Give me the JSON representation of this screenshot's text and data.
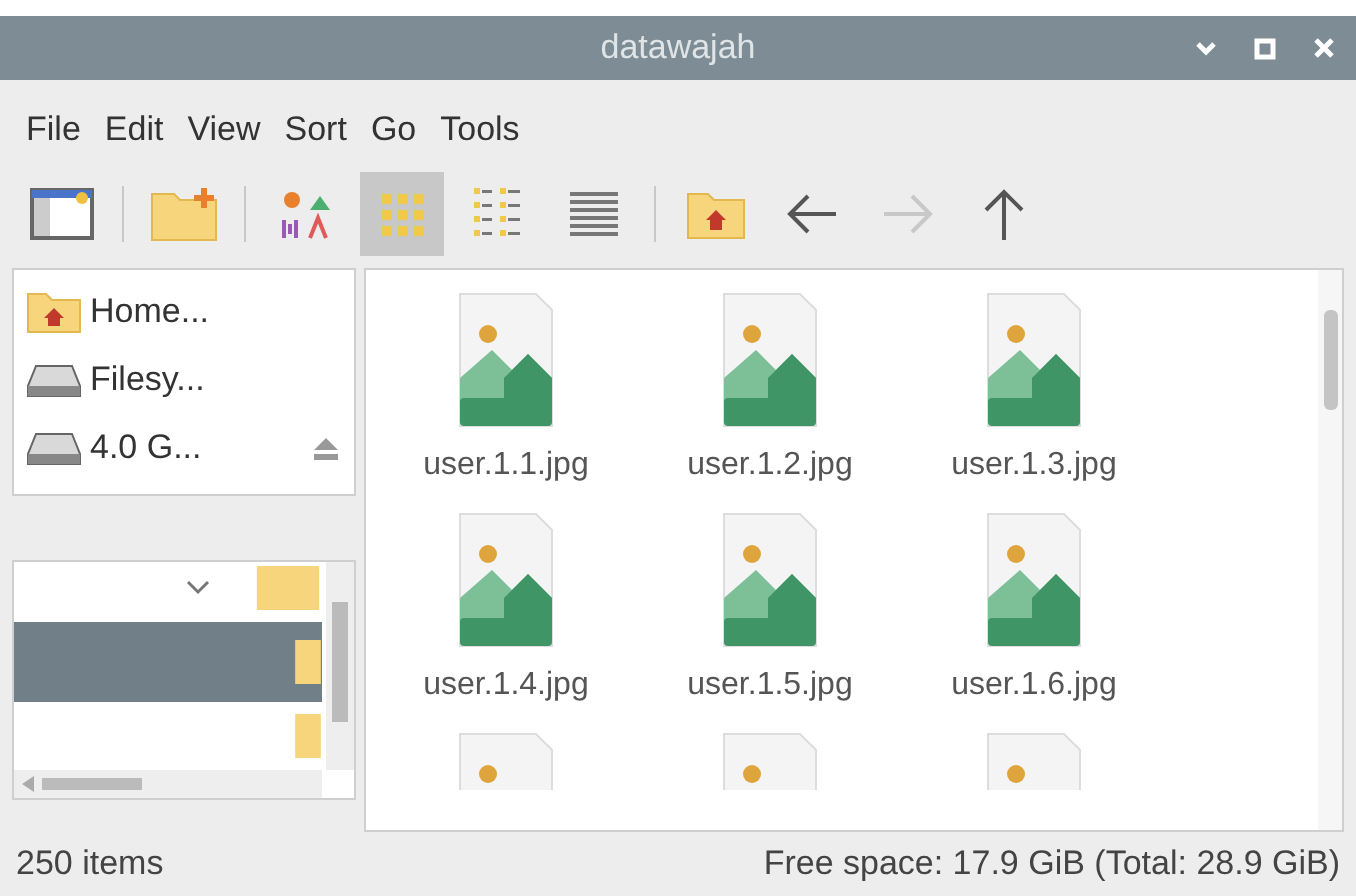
{
  "window": {
    "title": "datawajah"
  },
  "menu": [
    "File",
    "Edit",
    "View",
    "Sort",
    "Go",
    "Tools"
  ],
  "toolbar": [
    {
      "kind": "new-window",
      "selected": false
    },
    {
      "kind": "sep"
    },
    {
      "kind": "new-folder",
      "selected": false
    },
    {
      "kind": "sep"
    },
    {
      "kind": "thumbnail-view",
      "selected": false
    },
    {
      "kind": "icon-view",
      "selected": true
    },
    {
      "kind": "compact-view",
      "selected": false
    },
    {
      "kind": "list-view",
      "selected": false
    },
    {
      "kind": "sep"
    },
    {
      "kind": "home",
      "selected": false
    },
    {
      "kind": "back",
      "selected": false,
      "disabled": false
    },
    {
      "kind": "forward",
      "selected": false,
      "disabled": true
    },
    {
      "kind": "up",
      "selected": false,
      "disabled": false
    }
  ],
  "places": [
    {
      "kind": "home",
      "name": "Home...",
      "eject": false
    },
    {
      "kind": "drive",
      "name": "Filesy...",
      "eject": false
    },
    {
      "kind": "drive",
      "name": "4.0 G...",
      "eject": true
    }
  ],
  "tree_rows": [
    {
      "selected": false,
      "expander": true
    },
    {
      "selected": true,
      "expander": false
    },
    {
      "selected": false,
      "expander": false
    }
  ],
  "files": [
    {
      "kind": "file",
      "name": "user.1.1.jpg"
    },
    {
      "kind": "file",
      "name": "user.1.2.jpg"
    },
    {
      "kind": "file",
      "name": "user.1.3.jpg"
    },
    {
      "kind": "file",
      "name": "user.1.4.jpg"
    },
    {
      "kind": "file",
      "name": "user.1.5.jpg"
    },
    {
      "kind": "file",
      "name": "user.1.6.jpg"
    },
    {
      "kind": "cut-off"
    },
    {
      "kind": "cut-off"
    },
    {
      "kind": "cut-off"
    }
  ],
  "status_bar": {
    "count": "250 items",
    "space": "Free space: 17.9 GiB (Total: 28.9 GiB)"
  }
}
